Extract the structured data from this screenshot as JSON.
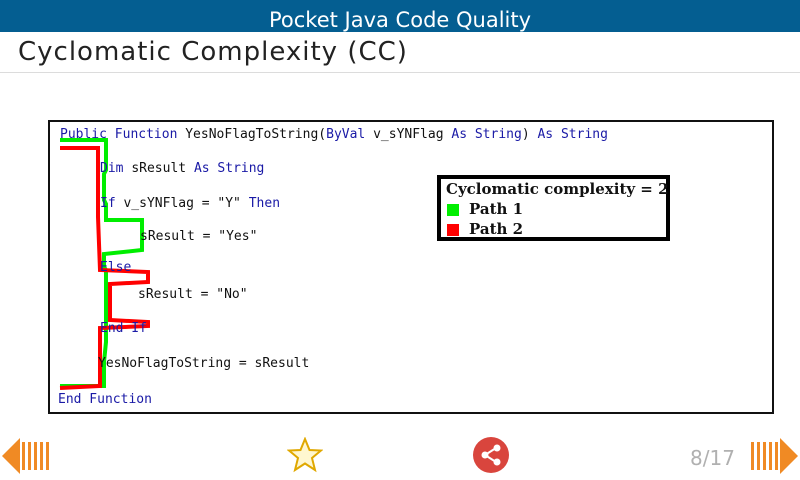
{
  "app": {
    "title": "Pocket Java Code Quality"
  },
  "page": {
    "title": "Cyclomatic Complexity (CC)"
  },
  "code": {
    "lines": [
      {
        "kw1": "Public Function ",
        "text": "YesNoFlagToString(",
        "kw2": "ByVal ",
        "text2": "v_sYNFlag ",
        "kw3": "As String",
        "text3": ") ",
        "kw4": "As String"
      },
      {
        "kw1": "Dim ",
        "text": "sResult ",
        "kw2": "As String"
      },
      {
        "kw1": "If ",
        "text": "v_sYNFlag = \"Y\" ",
        "kw2": "Then"
      },
      {
        "text": "sResult = \"Yes\""
      },
      {
        "kw1": "Else"
      },
      {
        "text": "sResult = \"No\""
      },
      {
        "kw1": "End If"
      },
      {
        "text": "YesNoFlagToString = sResult"
      },
      {
        "kw1": "End Function"
      }
    ]
  },
  "legend": {
    "title": "Cyclomatic complexity = 2",
    "items": [
      {
        "label": "Path 1",
        "color": "#00ee00"
      },
      {
        "label": "Path 2",
        "color": "#ff0000"
      }
    ]
  },
  "navigation": {
    "previous_icon": "arrow-left-icon",
    "next_icon": "arrow-right-icon",
    "favorite_icon": "star-icon",
    "share_icon": "share-icon",
    "page_indicator": "8/17"
  },
  "colors": {
    "app_bar": "#045e91",
    "accent": "#f08a24",
    "share": "#d9453d",
    "keyword": "#1a1aa6"
  }
}
